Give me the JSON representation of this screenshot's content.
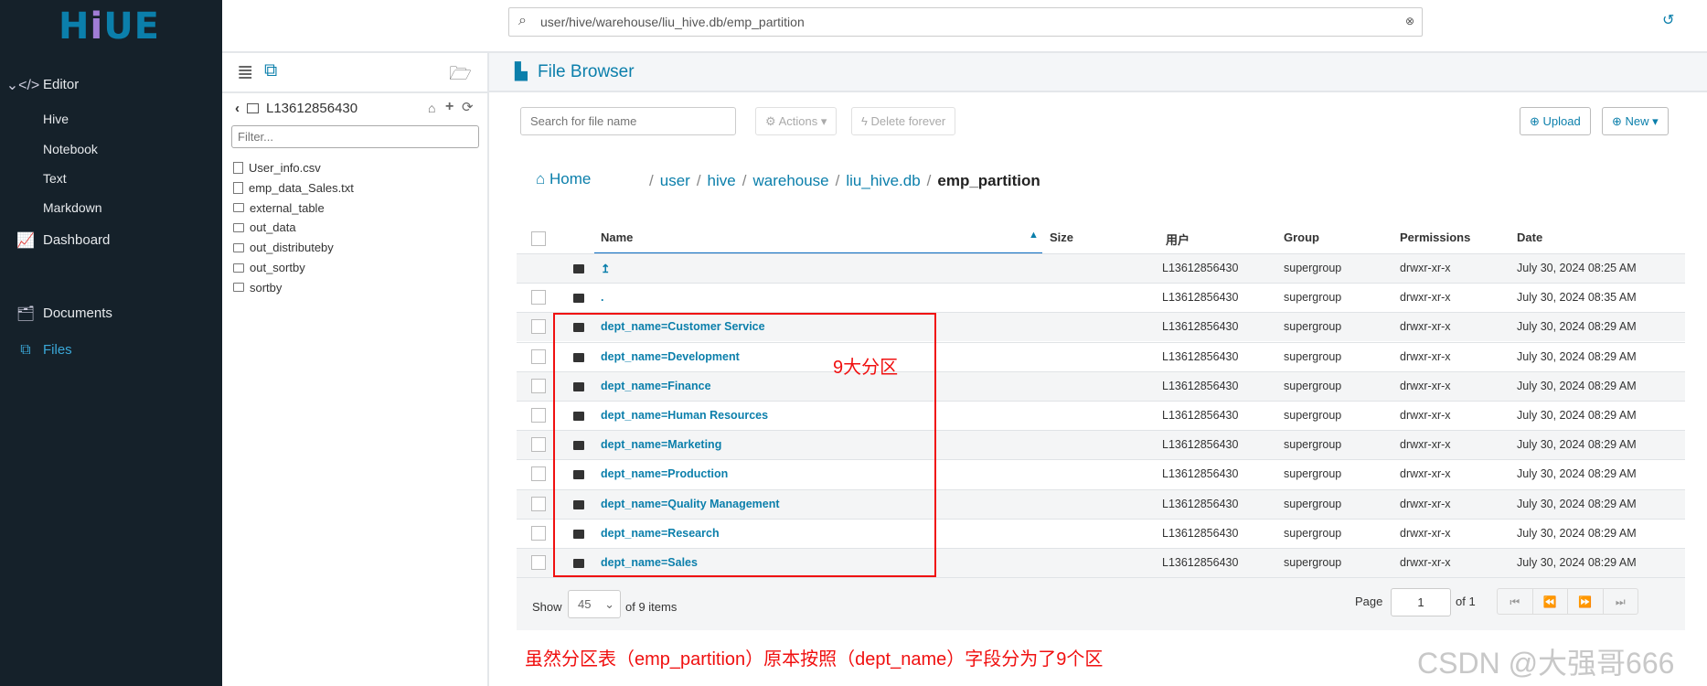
{
  "app": {
    "logo": "HUE"
  },
  "sidebar": {
    "items": [
      {
        "label": "Editor",
        "icon": "code-icon"
      },
      {
        "label": "Hive"
      },
      {
        "label": "Notebook"
      },
      {
        "label": "Text"
      },
      {
        "label": "Markdown"
      },
      {
        "label": "Dashboard",
        "icon": "chart-icon"
      },
      {
        "label": "Documents",
        "icon": "documents-icon"
      },
      {
        "label": "Files",
        "icon": "files-icon",
        "active": true
      }
    ]
  },
  "topbar": {
    "search_value": "user/hive/warehouse/liu_hive.db/emp_partition"
  },
  "leftpanel": {
    "user": "L13612856430",
    "filter_placeholder": "Filter...",
    "files": [
      {
        "name": "User_info.csv",
        "type": "file"
      },
      {
        "name": "emp_data_Sales.txt",
        "type": "file"
      },
      {
        "name": "external_table",
        "type": "folder"
      },
      {
        "name": "out_data",
        "type": "folder"
      },
      {
        "name": "out_distributeby",
        "type": "folder"
      },
      {
        "name": "out_sortby",
        "type": "folder"
      },
      {
        "name": "sortby",
        "type": "folder"
      }
    ]
  },
  "main": {
    "title": "File Browser",
    "search_placeholder": "Search for file name",
    "actions": "Actions",
    "delete": "Delete forever",
    "upload": "Upload",
    "new": "New",
    "breadcrumb": {
      "home": "Home",
      "parts": [
        "user",
        "hive",
        "warehouse",
        "liu_hive.db"
      ],
      "current": "emp_partition"
    },
    "columns": [
      "Name",
      "Size",
      "用户",
      "Group",
      "Permissions",
      "Date"
    ],
    "rows": [
      {
        "name": "↥",
        "user": "L13612856430",
        "group": "supergroup",
        "perm": "drwxr-xr-x",
        "date": "July 30, 2024 08:25 AM"
      },
      {
        "name": ".",
        "user": "L13612856430",
        "group": "supergroup",
        "perm": "drwxr-xr-x",
        "date": "July 30, 2024 08:35 AM"
      },
      {
        "name": "dept_name=Customer Service",
        "user": "L13612856430",
        "group": "supergroup",
        "perm": "drwxr-xr-x",
        "date": "July 30, 2024 08:29 AM"
      },
      {
        "name": "dept_name=Development",
        "user": "L13612856430",
        "group": "supergroup",
        "perm": "drwxr-xr-x",
        "date": "July 30, 2024 08:29 AM"
      },
      {
        "name": "dept_name=Finance",
        "user": "L13612856430",
        "group": "supergroup",
        "perm": "drwxr-xr-x",
        "date": "July 30, 2024 08:29 AM"
      },
      {
        "name": "dept_name=Human Resources",
        "user": "L13612856430",
        "group": "supergroup",
        "perm": "drwxr-xr-x",
        "date": "July 30, 2024 08:29 AM"
      },
      {
        "name": "dept_name=Marketing",
        "user": "L13612856430",
        "group": "supergroup",
        "perm": "drwxr-xr-x",
        "date": "July 30, 2024 08:29 AM"
      },
      {
        "name": "dept_name=Production",
        "user": "L13612856430",
        "group": "supergroup",
        "perm": "drwxr-xr-x",
        "date": "July 30, 2024 08:29 AM"
      },
      {
        "name": "dept_name=Quality Management",
        "user": "L13612856430",
        "group": "supergroup",
        "perm": "drwxr-xr-x",
        "date": "July 30, 2024 08:29 AM"
      },
      {
        "name": "dept_name=Research",
        "user": "L13612856430",
        "group": "supergroup",
        "perm": "drwxr-xr-x",
        "date": "July 30, 2024 08:29 AM"
      },
      {
        "name": "dept_name=Sales",
        "user": "L13612856430",
        "group": "supergroup",
        "perm": "drwxr-xr-x",
        "date": "July 30, 2024 08:29 AM"
      }
    ],
    "footer": {
      "show": "Show",
      "page_size": "45",
      "of_items": "of 9 items",
      "page": "Page",
      "page_value": "1",
      "of_pages": "of 1"
    }
  },
  "annotations": {
    "box_label": "9大分区",
    "note": "虽然分区表（emp_partition）原本按照（dept_name）字段分为了9个区",
    "watermark": "CSDN @大强哥666",
    "color": "#f01010"
  }
}
